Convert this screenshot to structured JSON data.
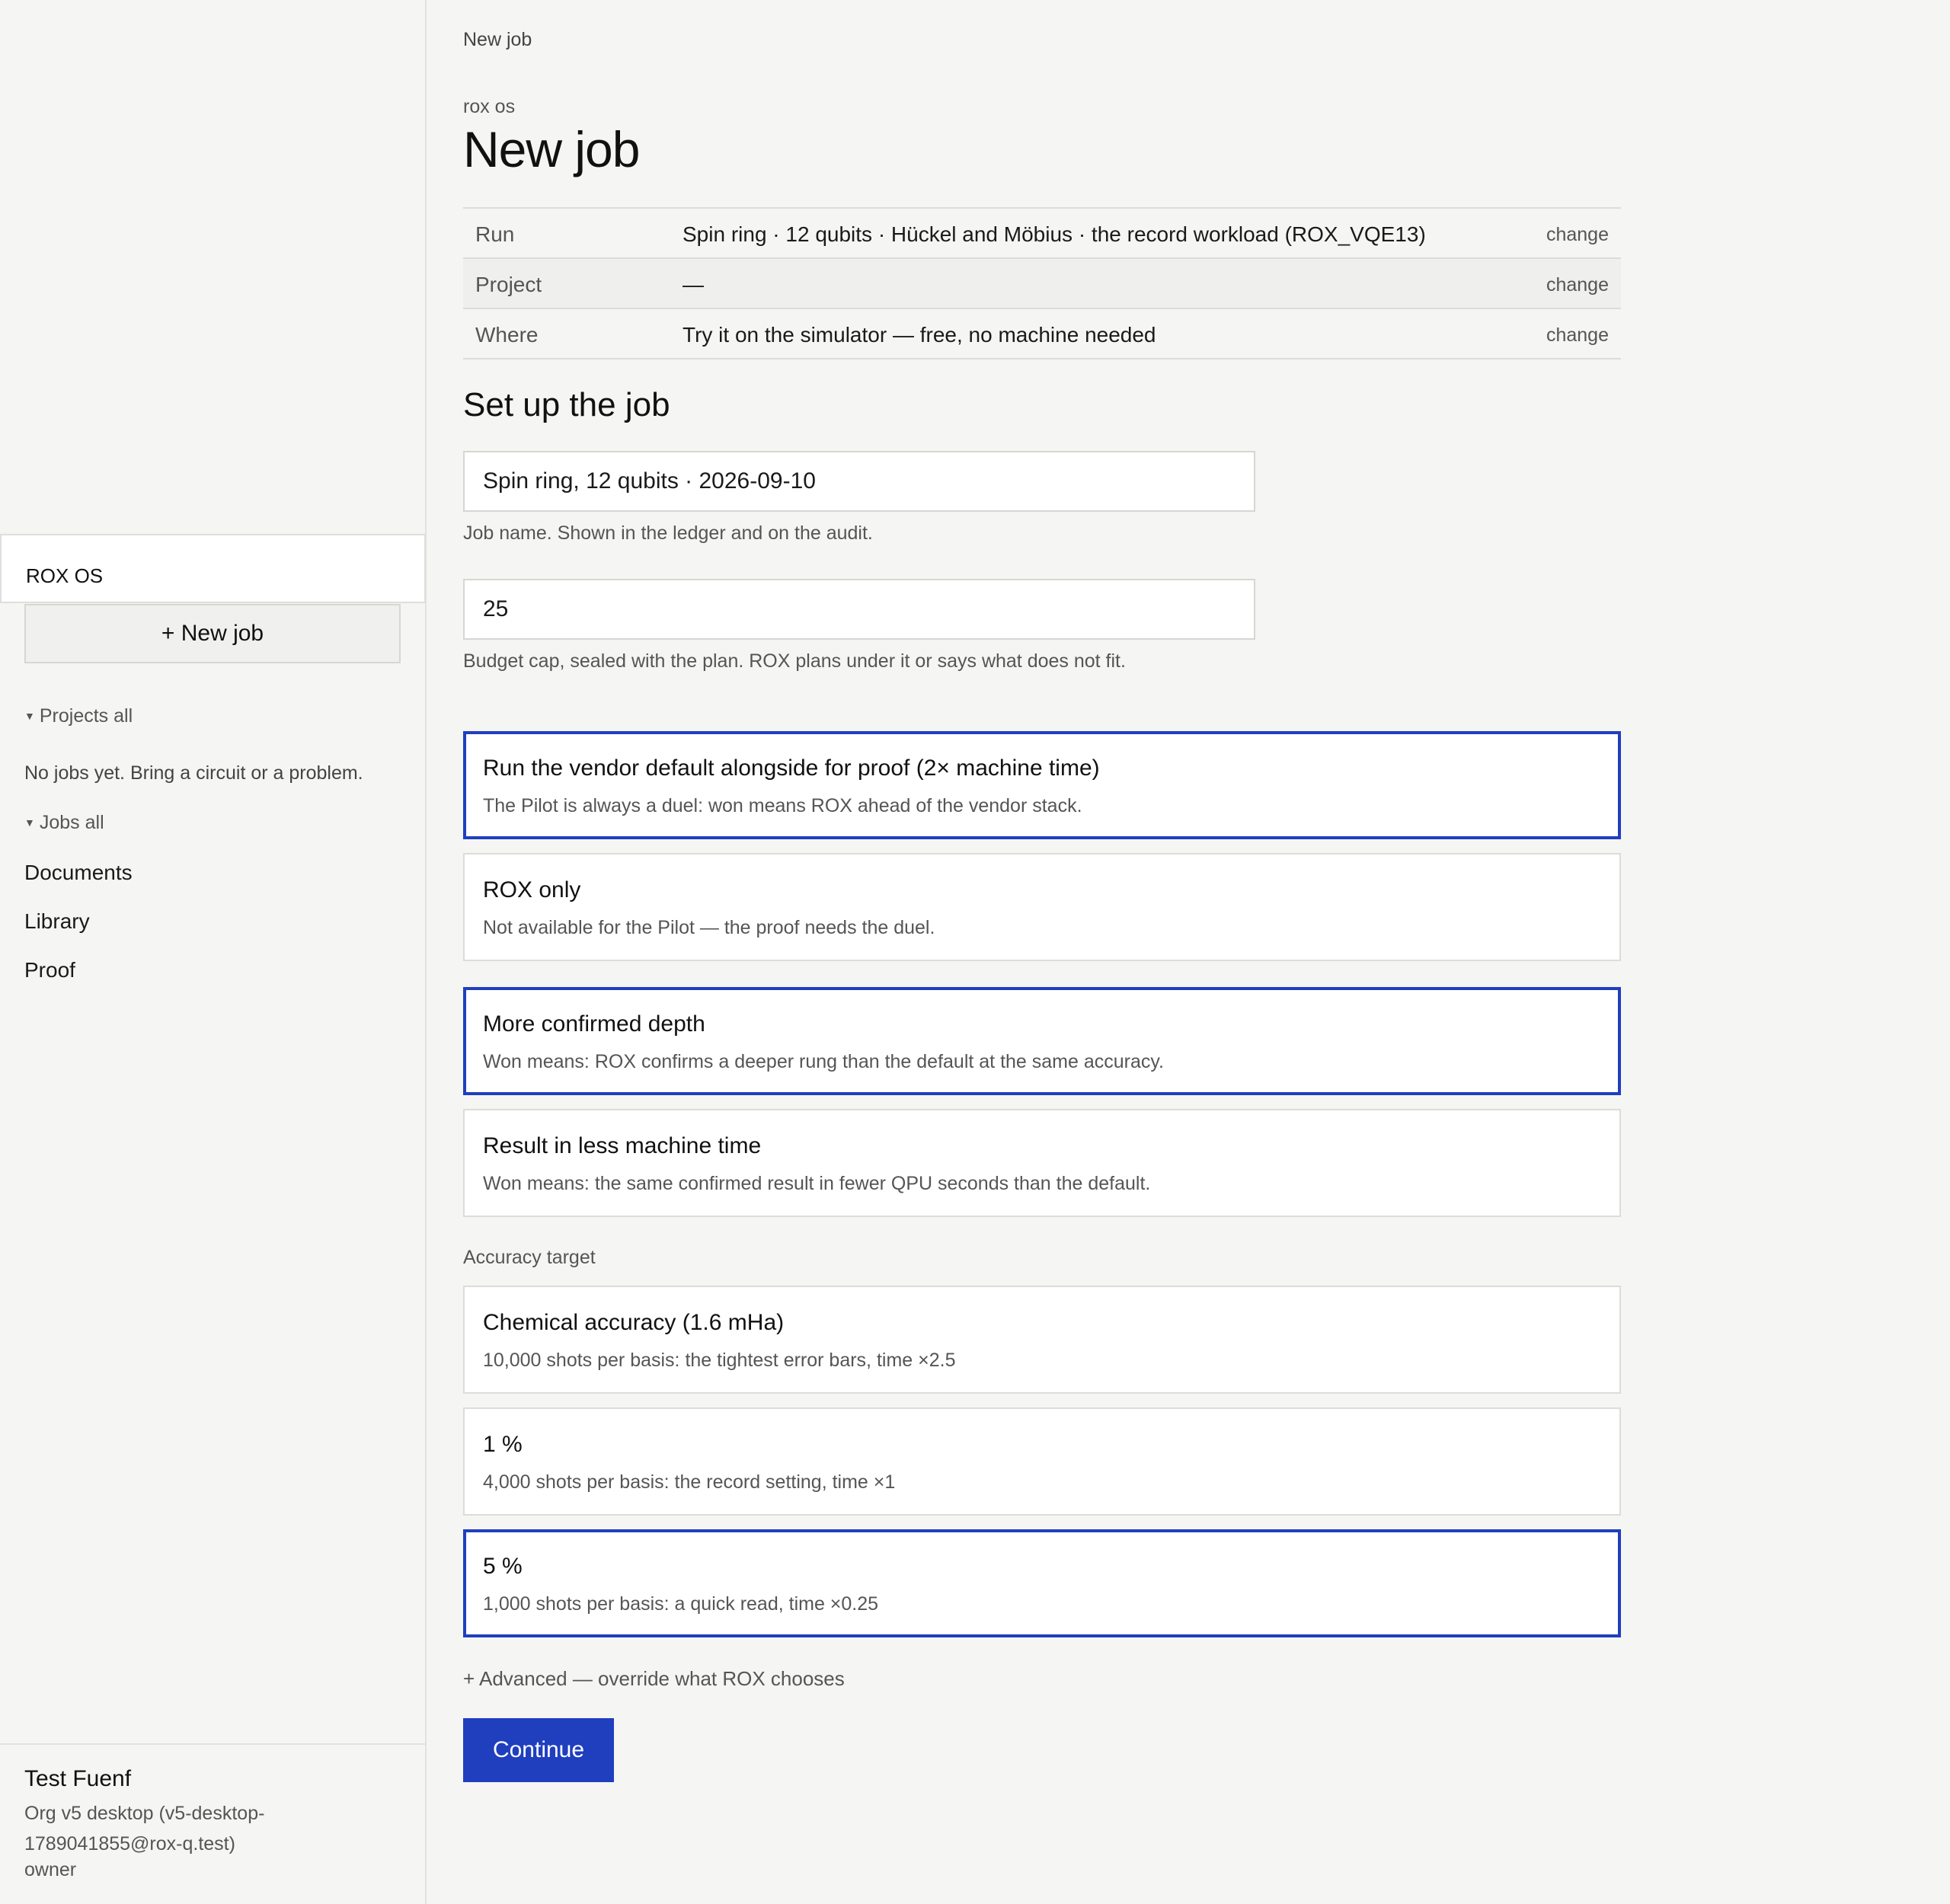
{
  "sidebar": {
    "brand": "ROX OS",
    "new_job": "+ New job",
    "projects_toggle": "Projects all",
    "empty_state": "No jobs yet. Bring a circuit or a problem.",
    "jobs_toggle": "Jobs all",
    "links": [
      "Documents",
      "Library",
      "Proof"
    ],
    "user": {
      "name": "Test Fuenf",
      "org": "Org v5 desktop (v5-desktop-1789041855@rox-q.test)",
      "role": "owner"
    }
  },
  "main": {
    "breadcrumb": "New job",
    "eyebrow": "rox os",
    "title": "New job",
    "summary": [
      {
        "key": "Run",
        "value": "Spin ring · 12 qubits · Hückel and Möbius · the record workload (ROX_VQE13)",
        "action": "change"
      },
      {
        "key": "Project",
        "value": "—",
        "action": "change"
      },
      {
        "key": "Where",
        "value": "Try it on the simulator — free, no machine needed",
        "action": "change"
      }
    ],
    "section_title": "Set up the job",
    "job_name": {
      "value": "Spin ring, 12 qubits · 2026-09-10",
      "hint": "Job name. Shown in the ledger and on the audit."
    },
    "budget": {
      "value": "25",
      "hint": "Budget cap, sealed with the plan. ROX plans under it or says what does not fit."
    },
    "mode_options": [
      {
        "title": "Run the vendor default alongside for proof (2× machine time)",
        "desc": "The Pilot is always a duel: won means ROX ahead of the vendor stack.",
        "selected": true
      },
      {
        "title": "ROX only",
        "desc": "Not available for the Pilot — the proof needs the duel.",
        "selected": false
      }
    ],
    "goal_options": [
      {
        "title": "More confirmed depth",
        "desc": "Won means: ROX confirms a deeper rung than the default at the same accuracy.",
        "selected": true
      },
      {
        "title": "Result in less machine time",
        "desc": "Won means: the same confirmed result in fewer QPU seconds than the default.",
        "selected": false
      }
    ],
    "accuracy_label": "Accuracy target",
    "accuracy_options": [
      {
        "title": "Chemical accuracy (1.6 mHa)",
        "desc": "10,000 shots per basis: the tightest error bars, time ×2.5",
        "selected": false
      },
      {
        "title": "1 %",
        "desc": "4,000 shots per basis: the record setting, time ×1",
        "selected": false
      },
      {
        "title": "5 %",
        "desc": "1,000 shots per basis: a quick read, time ×0.25",
        "selected": true
      }
    ],
    "advanced": "+ Advanced — override what ROX chooses",
    "continue": "Continue"
  },
  "colors": {
    "accent": "#1f3fbf",
    "background": "#f5f5f3",
    "surface": "#ffffff"
  }
}
